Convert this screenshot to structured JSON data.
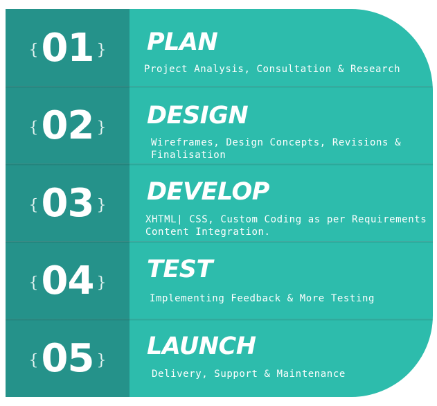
{
  "steps": [
    {
      "number": "01",
      "title": "PLAN",
      "description": "Project Analysis, Consultation & Research"
    },
    {
      "number": "02",
      "title": "DESIGN",
      "description": "Wireframes, Design Concepts, Revisions &\nFinalisation"
    },
    {
      "number": "03",
      "title": "DEVELOP",
      "description": "XHTML| CSS, Custom Coding as per Requirements\nContent Integration."
    },
    {
      "number": "04",
      "title": "TEST",
      "description": "Implementing Feedback & More Testing"
    },
    {
      "number": "05",
      "title": "LAUNCH",
      "description": "Delivery, Support & Maintenance"
    }
  ],
  "brace_open": "{",
  "brace_close": "}",
  "colors": {
    "teal": "#2dbcac",
    "dark_teal": "#25928a",
    "text": "#ffffff"
  }
}
